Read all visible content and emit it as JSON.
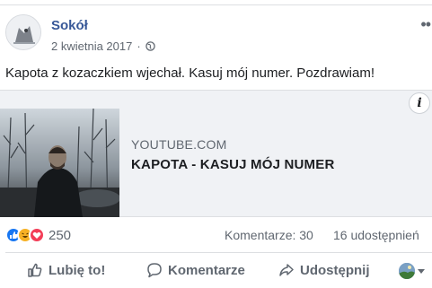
{
  "post": {
    "author": "Sokół",
    "date": "2 kwietnia 2017",
    "dot": "·",
    "text": "Kapota z kozaczkiem wjechał. Kasuj mój numer. Pozdrawiam!"
  },
  "link_preview": {
    "source": "YOUTUBE.COM",
    "title": "KAPOTA - KASUJ MÓJ NUMER",
    "info_glyph": "i"
  },
  "stats": {
    "reaction_count": "250",
    "reactions": [
      "like-icon",
      "haha-icon",
      "love-icon"
    ],
    "comments": "Komentarze: 30",
    "shares": "16 udostępnień"
  },
  "actions": {
    "like": "Lubię to!",
    "comment": "Komentarze",
    "share": "Udostępnij"
  },
  "colors": {
    "author": "#385898",
    "like": "#1877f2",
    "haha": "#f7b125",
    "love": "#f33e58",
    "muted": "#606770",
    "card_bg": "#f0f2f5"
  }
}
